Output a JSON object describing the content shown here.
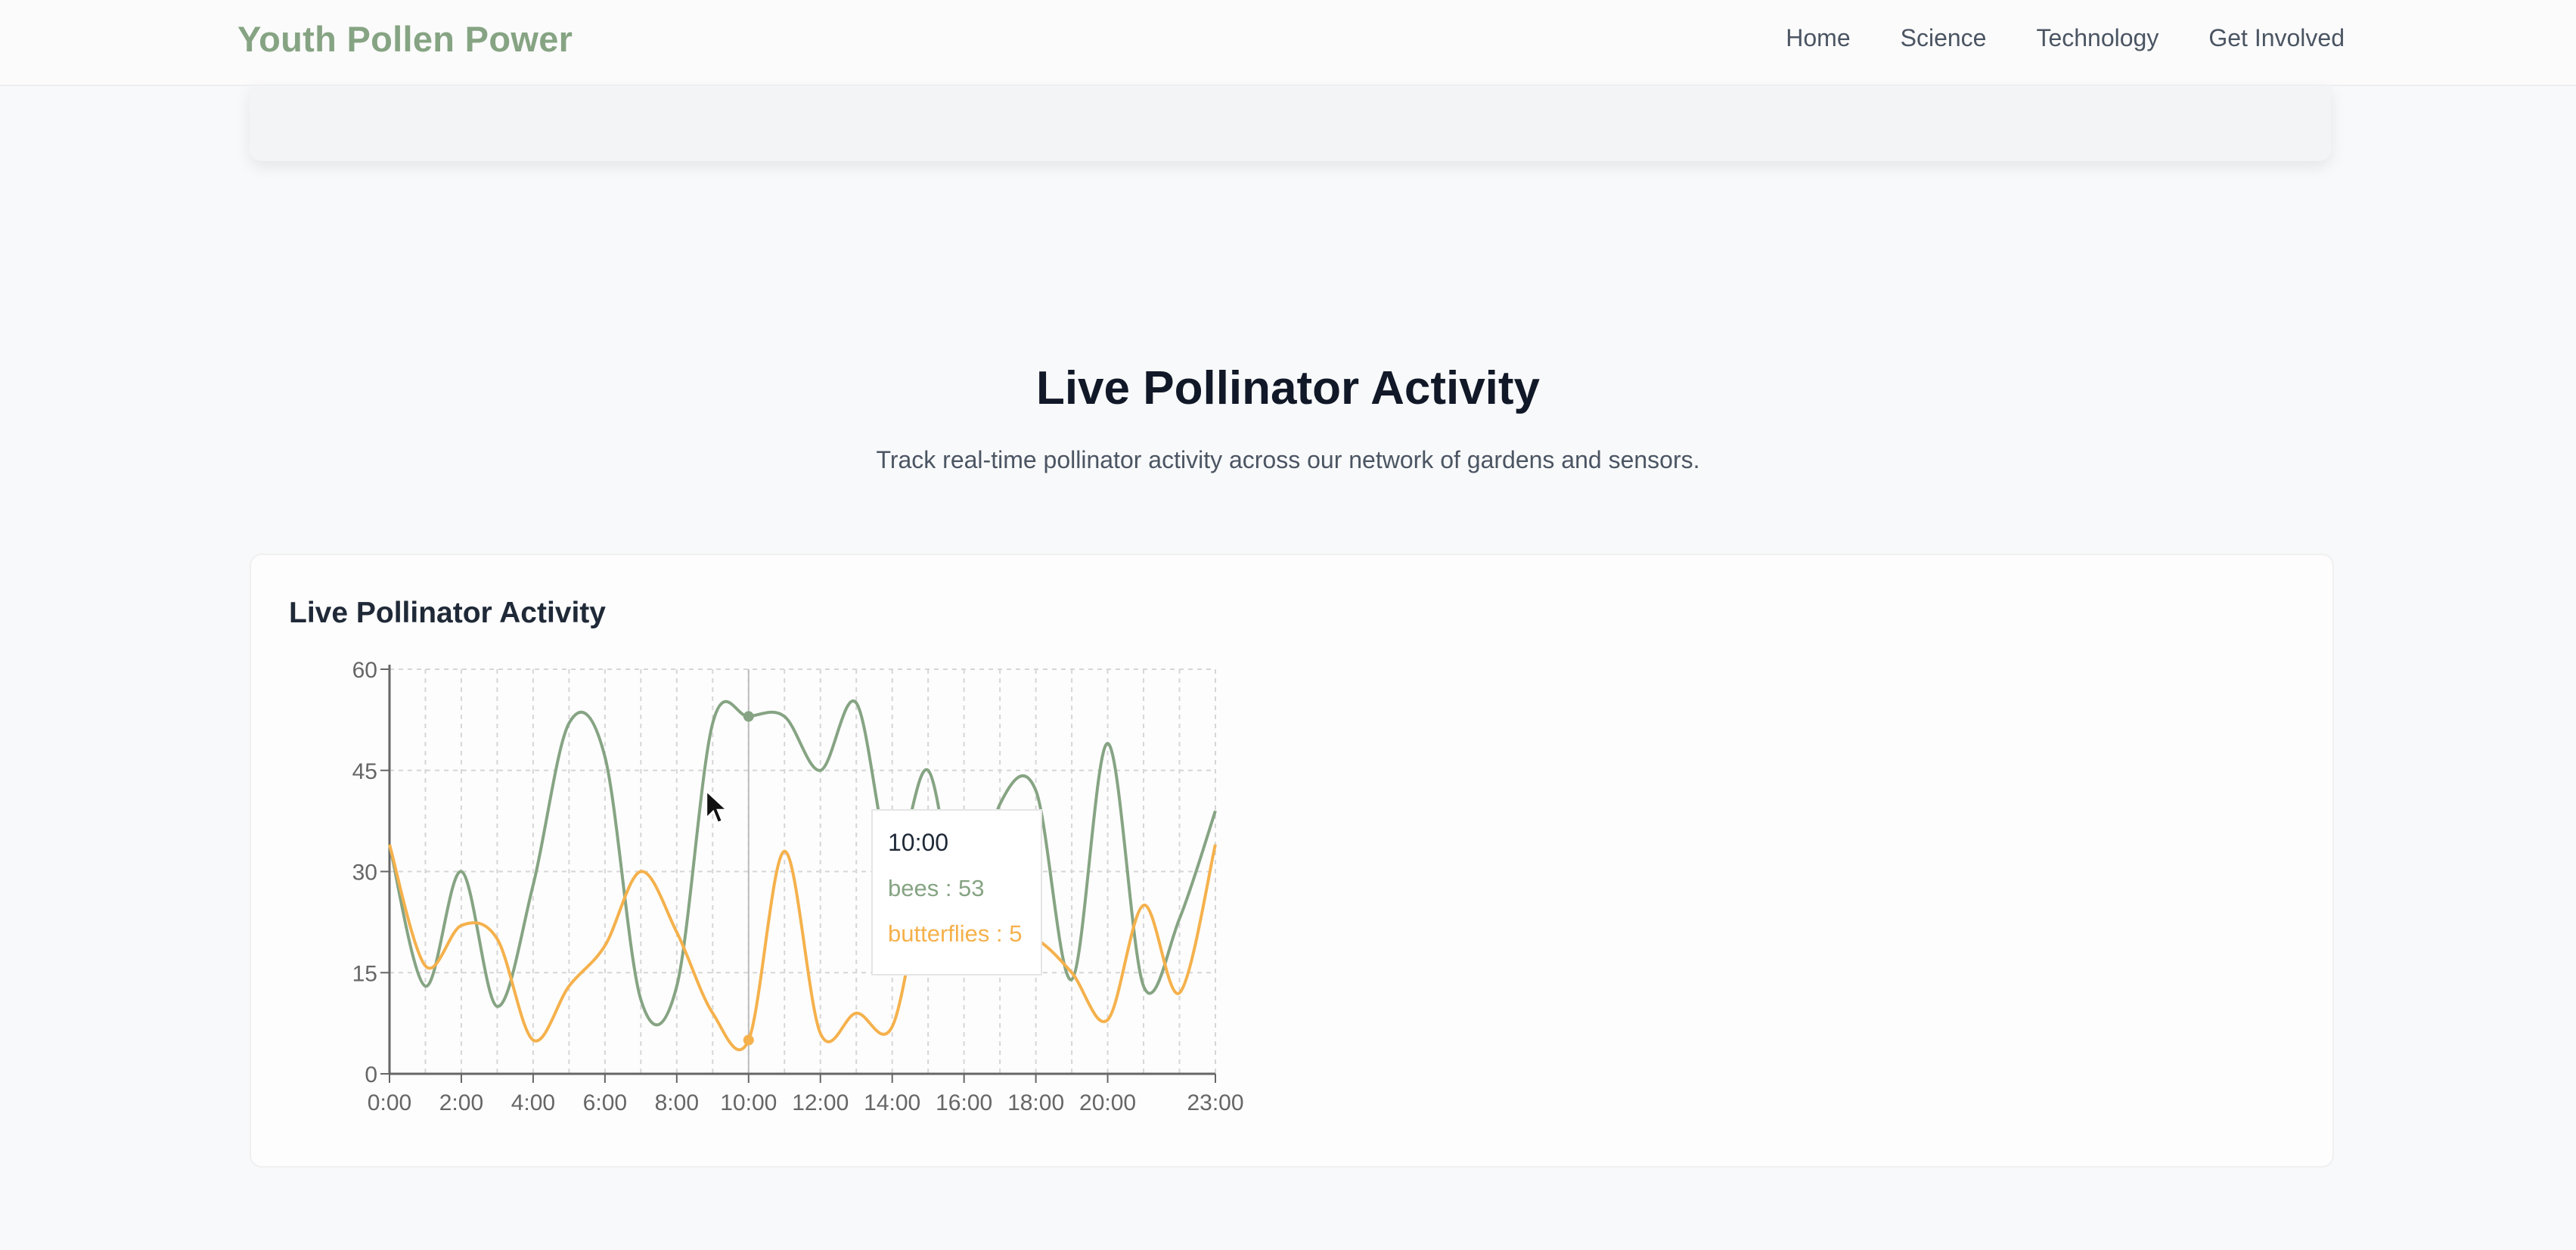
{
  "header": {
    "brand": "Youth Pollen Power",
    "nav": [
      "Home",
      "Science",
      "Technology",
      "Get Involved"
    ]
  },
  "section": {
    "title": "Live Pollinator Activity",
    "subtitle": "Track real-time pollinator activity across our network of gardens and sensors."
  },
  "chart": {
    "card_title": "Live Pollinator Activity",
    "tooltip": {
      "time": "10:00",
      "bees_text": "bees : 53",
      "butterflies_text": "butterflies : 5"
    }
  },
  "colors": {
    "bees": "#86a483",
    "butterflies": "#f5b14c",
    "brand": "#86a483"
  },
  "chart_data": {
    "type": "line",
    "x": [
      0,
      1,
      2,
      3,
      4,
      5,
      6,
      7,
      8,
      9,
      10,
      11,
      12,
      13,
      14,
      15,
      16,
      17,
      18,
      19,
      20,
      21,
      22,
      23
    ],
    "x_ticks": [
      {
        "x": 0,
        "label": "0:00"
      },
      {
        "x": 2,
        "label": "2:00"
      },
      {
        "x": 4,
        "label": "4:00"
      },
      {
        "x": 6,
        "label": "6:00"
      },
      {
        "x": 8,
        "label": "8:00"
      },
      {
        "x": 10,
        "label": "10:00"
      },
      {
        "x": 12,
        "label": "12:00"
      },
      {
        "x": 14,
        "label": "14:00"
      },
      {
        "x": 16,
        "label": "16:00"
      },
      {
        "x": 18,
        "label": "18:00"
      },
      {
        "x": 20,
        "label": "20:00"
      },
      {
        "x": 23,
        "label": "23:00"
      }
    ],
    "y_ticks": [
      0,
      15,
      30,
      45,
      60
    ],
    "ylim": [
      0,
      60
    ],
    "xlim": [
      0,
      23
    ],
    "grid": true,
    "active_x": 10,
    "series": [
      {
        "name": "bees",
        "color": "#86a483",
        "values": [
          34,
          13,
          30,
          10,
          28,
          52,
          47,
          11,
          13,
          52,
          53,
          53,
          45,
          55,
          31,
          45,
          21,
          40,
          42,
          14,
          49,
          13,
          23,
          39
        ]
      },
      {
        "name": "butterflies",
        "color": "#f5b14c",
        "values": [
          34,
          16,
          22,
          20,
          5,
          13,
          19,
          30,
          21,
          9,
          5,
          33,
          6,
          9,
          7,
          30,
          31,
          21,
          20,
          15,
          8,
          25,
          12,
          34
        ]
      }
    ]
  }
}
